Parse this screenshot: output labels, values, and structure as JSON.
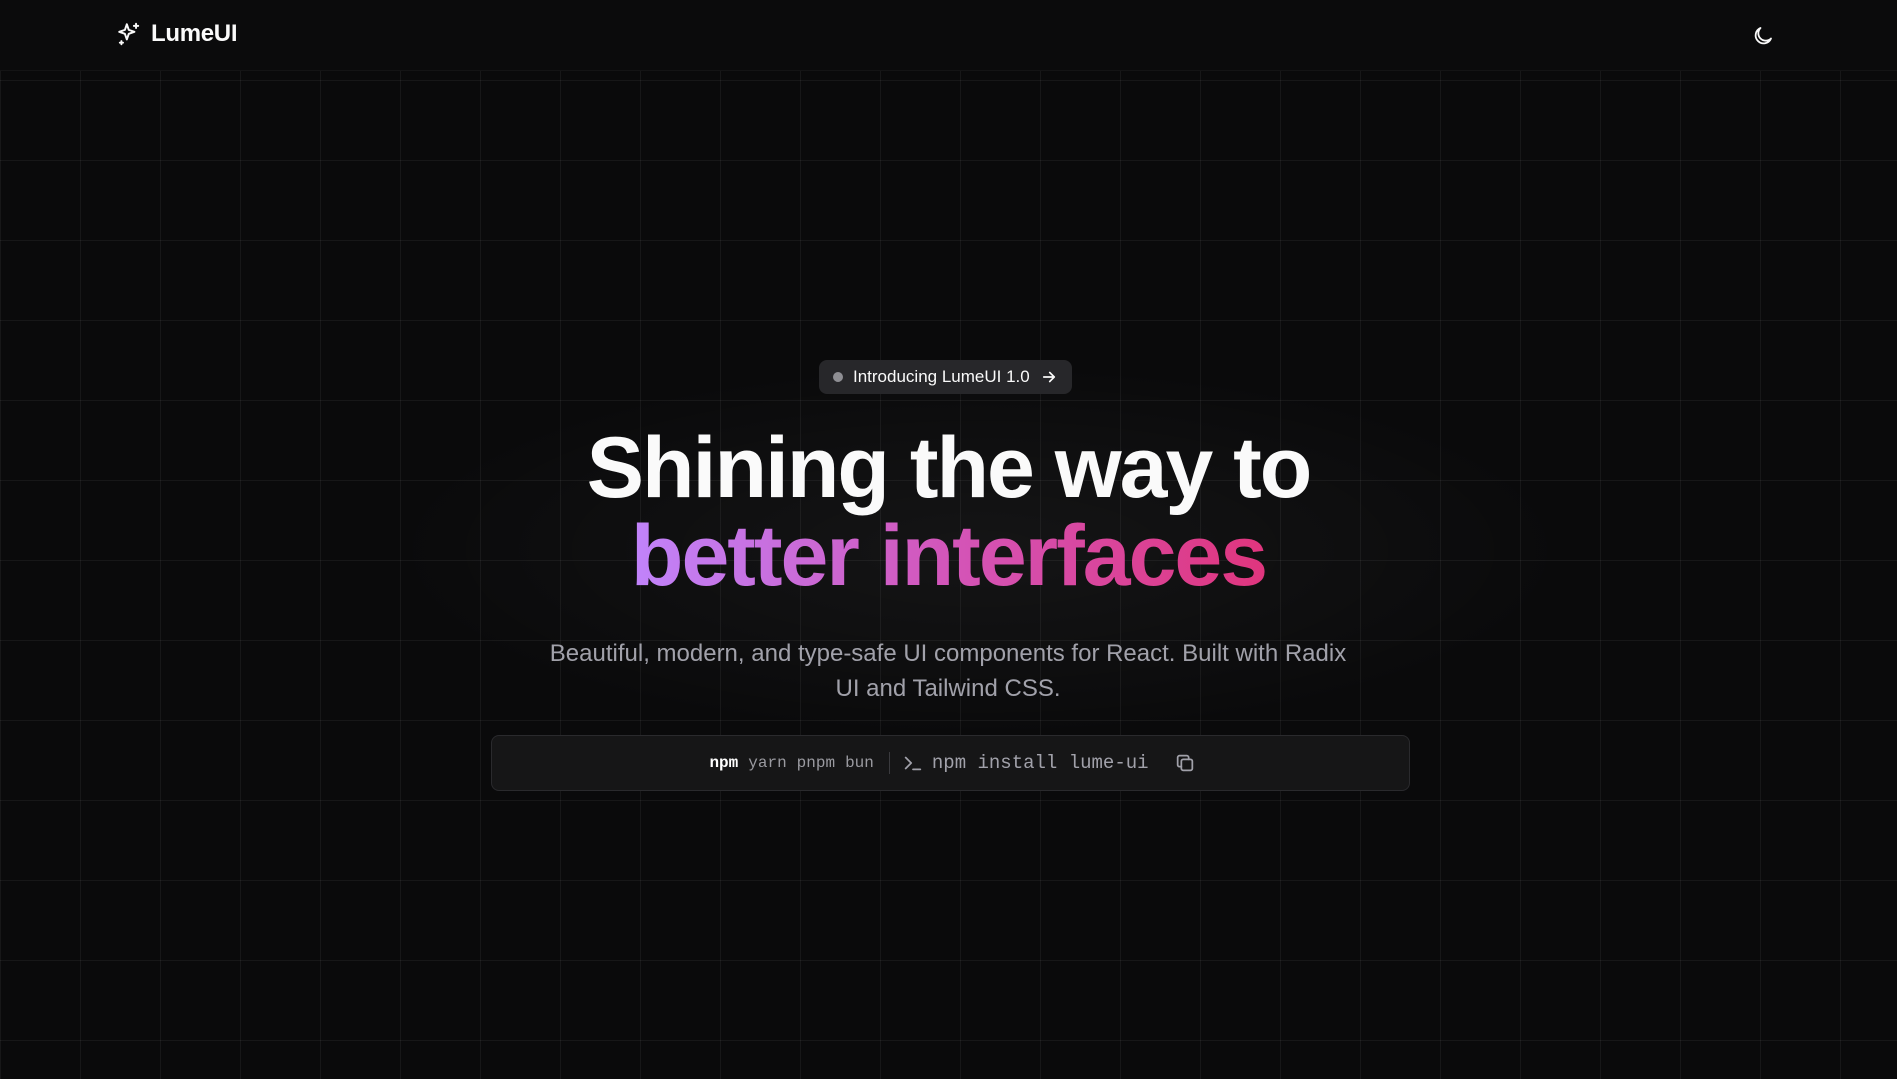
{
  "header": {
    "brand_name": "LumeUI",
    "brand_icon": "sparkles-icon",
    "theme_toggle_icon": "moon-icon"
  },
  "hero": {
    "announcement": {
      "label": "Introducing LumeUI 1.0",
      "icon": "arrow-right-icon"
    },
    "headline_line1": "Shining the way to",
    "headline_line2": "better interfaces",
    "subtitle": "Beautiful, modern, and type-safe UI components for React. Built with Radix UI and Tailwind CSS."
  },
  "install": {
    "package_managers": [
      "npm",
      "yarn",
      "pnpm",
      "bun"
    ],
    "active_manager": "npm",
    "prompt_icon": "terminal-prompt-icon",
    "command": "npm install lume-ui",
    "copy_icon": "copy-icon"
  },
  "colors": {
    "background": "#0a0a0b",
    "gradient_start": "#c084fc",
    "gradient_mid": "#d355b9",
    "gradient_end": "#e0357d",
    "muted_text": "#a1a1aa"
  }
}
